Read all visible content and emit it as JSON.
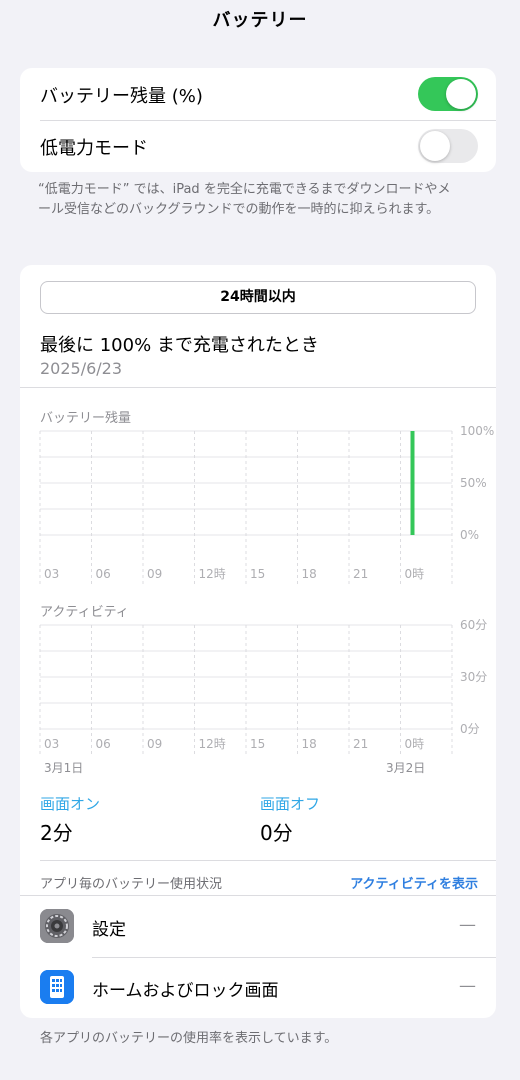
{
  "nav": {
    "title": "バッテリー"
  },
  "settings": {
    "battery_percent_label": "バッテリー残量 (%)",
    "battery_percent_on": true,
    "low_power_label": "低電力モード",
    "low_power_on": false
  },
  "footnote": "“低電力モード” では、iPad を完全に充電できるまでダウンロードやメール受信などのバックグラウンドでの動作を一時的に抑えられます。",
  "segment": {
    "label": "24時間以内"
  },
  "last_charge": {
    "label": "最後に 100% まで充電されたとき",
    "date": "2025/6/23"
  },
  "chart_data": [
    {
      "type": "bar",
      "title": "バッテリー残量",
      "categories": [
        "03",
        "06",
        "09",
        "12時",
        "15",
        "18",
        "21",
        "0時"
      ],
      "y_ticks": [
        "100%",
        "50%",
        "0%"
      ],
      "ylim": [
        0,
        100
      ],
      "series": [
        {
          "values": [
            0,
            0,
            0,
            0,
            0,
            0,
            0,
            100
          ]
        }
      ],
      "color": "#34c759",
      "grid": true
    },
    {
      "type": "bar",
      "title": "アクティビティ",
      "categories": [
        "03",
        "06",
        "09",
        "12時",
        "15",
        "18",
        "21",
        "0時"
      ],
      "y_ticks": [
        "60分",
        "30分",
        "0分"
      ],
      "ylim": [
        0,
        60
      ],
      "series": [
        {
          "values": [
            0,
            0,
            0,
            0,
            0,
            0,
            0,
            0
          ]
        }
      ],
      "grid": true,
      "date_labels": [
        "3月1日",
        "3月2日"
      ]
    }
  ],
  "stats": {
    "screen_on_label": "画面オン",
    "screen_on_value": "2分",
    "screen_off_label": "画面オフ",
    "screen_off_value": "0分"
  },
  "usage": {
    "header": "アプリ毎のバッテリー使用状況",
    "show_activity": "アクティビティを表示",
    "apps": [
      {
        "name": "設定",
        "icon": "settings-gear-icon",
        "value": "—"
      },
      {
        "name": "ホームおよびロック画面",
        "icon": "home-lock-screen-icon",
        "value": "—"
      }
    ]
  },
  "bottom_note": "各アプリのバッテリーの使用率を表示しています。",
  "colors": {
    "accent_green": "#34c759",
    "link_blue": "#2f7fe0",
    "stat_blue": "#30a7e6",
    "background": "#f2f2f7"
  }
}
